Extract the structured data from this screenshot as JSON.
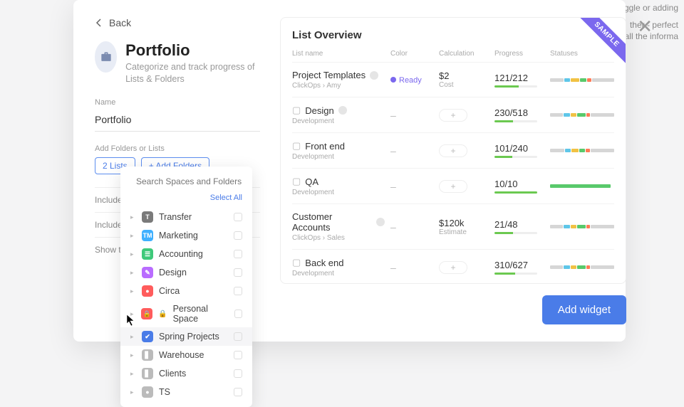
{
  "back_label": "Back",
  "header": {
    "title": "Portfolio",
    "subtitle": "Categorize and track progress of Lists & Folders"
  },
  "name_field": {
    "label": "Name",
    "value": "Portfolio"
  },
  "add_section": {
    "label": "Add Folders or Lists",
    "chip_lists": "2 Lists",
    "chip_add": "+ Add Folders"
  },
  "options": [
    "Include su",
    "Include are",
    "Show task more than"
  ],
  "dropdown": {
    "placeholder": "Search Spaces and Folders",
    "select_all": "Select All",
    "items": [
      {
        "label": "Transfer",
        "icon_bg": "#7a7a7a",
        "icon_txt": "T"
      },
      {
        "label": "Marketing",
        "icon_bg": "#3fb0ff",
        "icon_txt": "TM"
      },
      {
        "label": "Accounting",
        "icon_bg": "#3ec97a",
        "icon_txt": "☰"
      },
      {
        "label": "Design",
        "icon_bg": "#b96cff",
        "icon_txt": "✎"
      },
      {
        "label": "Circa",
        "icon_bg": "#ff5c5c",
        "icon_txt": "●"
      },
      {
        "label": "Personal Space",
        "icon_bg": "#ff5c5c",
        "icon_txt": "🔒",
        "lock": true
      },
      {
        "label": "Spring Projects",
        "icon_bg": "#4a7ce8",
        "icon_txt": "✔",
        "hover": true
      },
      {
        "label": "Warehouse",
        "icon_bg": "#bbbbbb",
        "icon_txt": "▋",
        "muted": true
      },
      {
        "label": "Clients",
        "icon_bg": "#bbbbbb",
        "icon_txt": "▋",
        "muted": true
      },
      {
        "label": "TS",
        "icon_bg": "#bbbbbb",
        "icon_txt": "●",
        "muted": true
      }
    ]
  },
  "overview": {
    "title": "List Overview",
    "sample": "SAMPLE",
    "headers": {
      "name": "List name",
      "color": "Color",
      "calc": "Calculation",
      "progress": "Progress",
      "statuses": "Statuses"
    },
    "rows": [
      {
        "name": "Project Templates",
        "sub": "ClickOps  ›  Amy",
        "has_info": true,
        "color_type": "ready",
        "color_label": "Ready",
        "calc": "$2",
        "calc_sub": "Cost",
        "progress": "121/212",
        "pct": 57,
        "statuses": [
          [
            "#d6d6d6",
            20
          ],
          [
            "#5fc6e8",
            8
          ],
          [
            "#f1c244",
            12
          ],
          [
            "#59c96b",
            10
          ],
          [
            "#ff7b57",
            6
          ],
          [
            "#d6d6d6",
            32
          ]
        ]
      },
      {
        "name": "Design",
        "sub": "Development",
        "folder": true,
        "has_info": true,
        "color_type": "dash",
        "calc_type": "pill",
        "progress": "230/518",
        "pct": 44,
        "statuses": [
          [
            "#d6d6d6",
            18
          ],
          [
            "#5fc6e8",
            10
          ],
          [
            "#f1c244",
            8
          ],
          [
            "#59c96b",
            12
          ],
          [
            "#ff7b57",
            5
          ],
          [
            "#d6d6d6",
            34
          ]
        ]
      },
      {
        "name": "Front end",
        "sub": "Development",
        "folder": true,
        "color_type": "dash",
        "calc_type": "pill",
        "progress": "101/240",
        "pct": 42,
        "statuses": [
          [
            "#d6d6d6",
            20
          ],
          [
            "#5fc6e8",
            9
          ],
          [
            "#f1c244",
            10
          ],
          [
            "#59c96b",
            8
          ],
          [
            "#ff7b57",
            6
          ],
          [
            "#d6d6d6",
            34
          ]
        ]
      },
      {
        "name": "QA",
        "sub": "Development",
        "folder": true,
        "color_type": "dash",
        "calc_type": "pill",
        "progress": "10/10",
        "pct": 100,
        "statuses": [
          [
            "#59c96b",
            85
          ]
        ]
      },
      {
        "name": "Customer Accounts",
        "sub": "ClickOps  ›  Sales",
        "has_info": true,
        "color_type": "dash",
        "calc": "$120k",
        "calc_sub": "Estimate",
        "progress": "21/48",
        "pct": 44,
        "statuses": [
          [
            "#d6d6d6",
            18
          ],
          [
            "#5fc6e8",
            10
          ],
          [
            "#f1c244",
            8
          ],
          [
            "#59c96b",
            12
          ],
          [
            "#ff7b57",
            5
          ],
          [
            "#d6d6d6",
            34
          ]
        ]
      },
      {
        "name": "Back end",
        "sub": "Development",
        "folder": true,
        "color_type": "dash",
        "calc_type": "pill",
        "progress": "310/627",
        "pct": 49,
        "statuses": [
          [
            "#d6d6d6",
            18
          ],
          [
            "#5fc6e8",
            10
          ],
          [
            "#f1c244",
            8
          ],
          [
            "#59c96b",
            12
          ],
          [
            "#ff7b57",
            5
          ],
          [
            "#d6d6d6",
            34
          ]
        ]
      }
    ]
  },
  "add_widget": "Add widget"
}
